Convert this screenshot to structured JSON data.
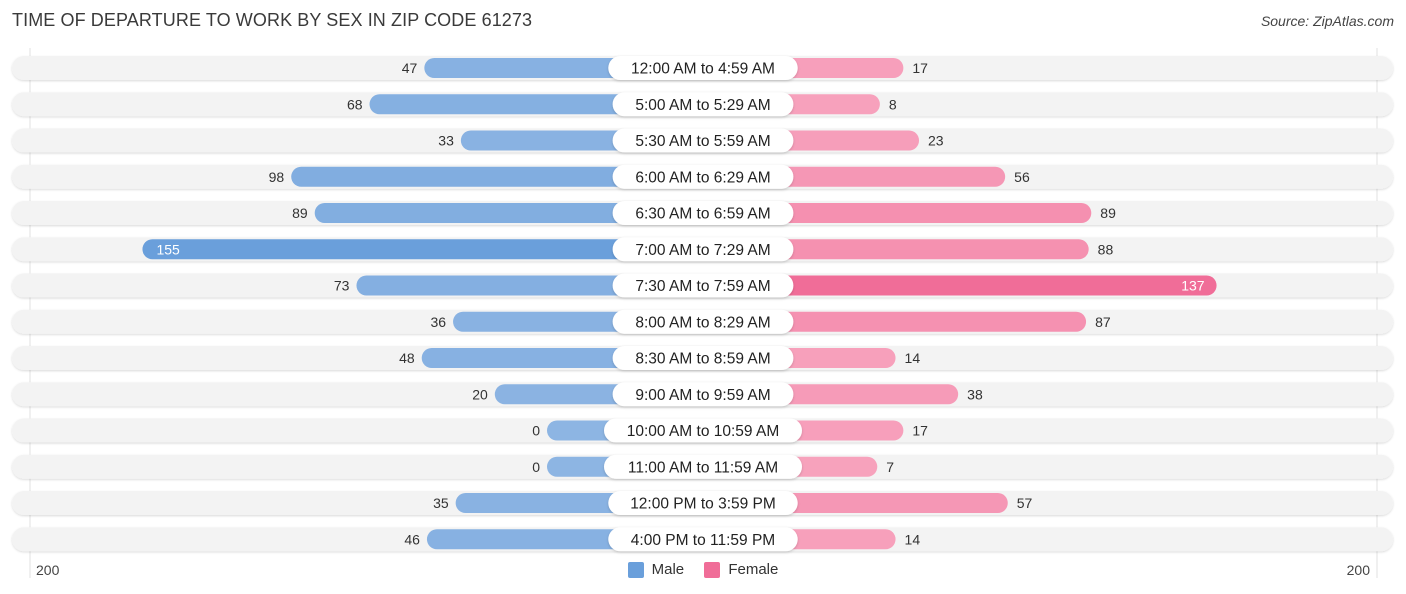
{
  "header": {
    "title": "TIME OF DEPARTURE TO WORK BY SEX IN ZIP CODE 61273",
    "source": "Source: ZipAtlas.com"
  },
  "colors": {
    "male": "#8db5e3",
    "male_strong": "#6a9fdb",
    "female": "#f7a3bd",
    "female_strong": "#f06d98",
    "row_bg": "#f3f3f3",
    "label_bg": "#ffffff"
  },
  "chart_data": {
    "type": "bar",
    "orientation": "horizontal-diverging",
    "title": "TIME OF DEPARTURE TO WORK BY SEX IN ZIP CODE 61273",
    "xlabel": "",
    "ylabel": "",
    "xlim": [
      -200,
      200
    ],
    "axis_tick_labels": {
      "left": "200",
      "right": "200"
    },
    "legend_position": "bottom-center",
    "grid": false,
    "categories": [
      "12:00 AM to 4:59 AM",
      "5:00 AM to 5:29 AM",
      "5:30 AM to 5:59 AM",
      "6:00 AM to 6:29 AM",
      "6:30 AM to 6:59 AM",
      "7:00 AM to 7:29 AM",
      "7:30 AM to 7:59 AM",
      "8:00 AM to 8:29 AM",
      "8:30 AM to 8:59 AM",
      "9:00 AM to 9:59 AM",
      "10:00 AM to 10:59 AM",
      "11:00 AM to 11:59 AM",
      "12:00 PM to 3:59 PM",
      "4:00 PM to 11:59 PM"
    ],
    "series": [
      {
        "name": "Male",
        "side": "left",
        "values": [
          47,
          68,
          33,
          98,
          89,
          155,
          73,
          36,
          48,
          20,
          0,
          0,
          35,
          46
        ]
      },
      {
        "name": "Female",
        "side": "right",
        "values": [
          17,
          8,
          23,
          56,
          89,
          88,
          137,
          87,
          14,
          38,
          17,
          7,
          57,
          14
        ]
      }
    ]
  },
  "legend": {
    "items": [
      {
        "label": "Male"
      },
      {
        "label": "Female"
      }
    ]
  }
}
